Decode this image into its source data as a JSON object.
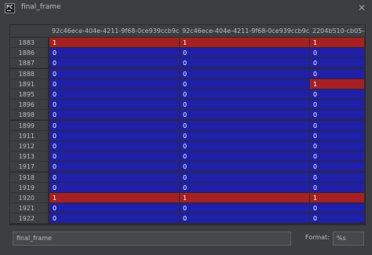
{
  "window": {
    "title": "final_frame",
    "app_icon_text": "PC",
    "close_glyph": "✕"
  },
  "table": {
    "columns": [
      "92c46ece-404e-4211-9f68-0ce939ccb9c5|9c14...",
      "92c46ece-404e-4211-9f68-0ce939ccb9c5|920f...",
      "2204b510-cb05-4d..."
    ],
    "rows": [
      {
        "index": "1883",
        "values": [
          "1",
          "1",
          "1"
        ]
      },
      {
        "index": "1886",
        "values": [
          "0",
          "0",
          "0"
        ]
      },
      {
        "index": "1887",
        "values": [
          "0",
          "0",
          "0"
        ]
      },
      {
        "index": "1888",
        "values": [
          "0",
          "0",
          "0"
        ]
      },
      {
        "index": "1891",
        "values": [
          "0",
          "0",
          "1"
        ]
      },
      {
        "index": "1895",
        "values": [
          "0",
          "0",
          "0"
        ]
      },
      {
        "index": "1896",
        "values": [
          "0",
          "0",
          "0"
        ]
      },
      {
        "index": "1898",
        "values": [
          "0",
          "0",
          "0"
        ]
      },
      {
        "index": "1899",
        "values": [
          "0",
          "0",
          "0"
        ]
      },
      {
        "index": "1911",
        "values": [
          "0",
          "0",
          "0"
        ]
      },
      {
        "index": "1912",
        "values": [
          "0",
          "0",
          "0"
        ]
      },
      {
        "index": "1913",
        "values": [
          "0",
          "0",
          "0"
        ]
      },
      {
        "index": "1917",
        "values": [
          "0",
          "0",
          "0"
        ]
      },
      {
        "index": "1918",
        "values": [
          "0",
          "0",
          "0"
        ]
      },
      {
        "index": "1919",
        "values": [
          "0",
          "0",
          "0"
        ]
      },
      {
        "index": "1920",
        "values": [
          "1",
          "1",
          "1"
        ]
      },
      {
        "index": "1921",
        "values": [
          "0",
          "0",
          "0"
        ]
      },
      {
        "index": "1922",
        "values": [
          "0",
          "0",
          "0"
        ]
      }
    ],
    "colors": {
      "value_0": "#1f1fa8",
      "value_1": "#a81f1f"
    }
  },
  "footer": {
    "expression_value": "final_frame",
    "format_label": "Format:",
    "format_value": "%s"
  }
}
